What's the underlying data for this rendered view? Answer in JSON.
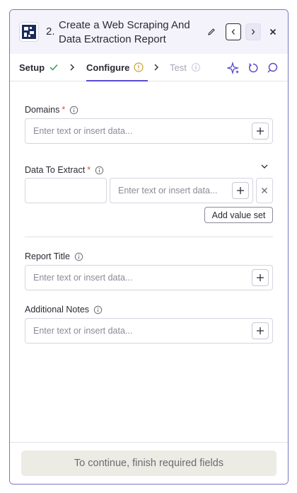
{
  "header": {
    "step_number": "2.",
    "title": "Create a Web Scraping And Data Extraction Report",
    "logo_icon": "app-grid-logo",
    "edit_icon": "pencil-icon",
    "prev_icon": "chevron-left-icon",
    "next_icon": "chevron-right-icon",
    "close_icon": "close-icon"
  },
  "tabs": {
    "setup": "Setup",
    "configure": "Configure",
    "test": "Test",
    "actions": [
      "sparkle-icon",
      "refresh-icon",
      "comment-icon"
    ]
  },
  "fields": {
    "domains": {
      "label": "Domains",
      "required": "*",
      "placeholder": "Enter text or insert data..."
    },
    "data_to_extract": {
      "label": "Data To Extract",
      "required": "*",
      "key_value": "",
      "value_placeholder": "Enter text or insert data...",
      "add_value_set_label": "Add value set"
    },
    "report_title": {
      "label": "Report Title",
      "placeholder": "Enter text or insert data..."
    },
    "additional_notes": {
      "label": "Additional Notes",
      "placeholder": "Enter text or insert data..."
    }
  },
  "footer": {
    "continue_label": "To continue, finish required fields"
  },
  "colors": {
    "accent": "#5a4bd1",
    "required": "#e0533a",
    "success": "#2e9e5b",
    "warning": "#c9a227"
  }
}
